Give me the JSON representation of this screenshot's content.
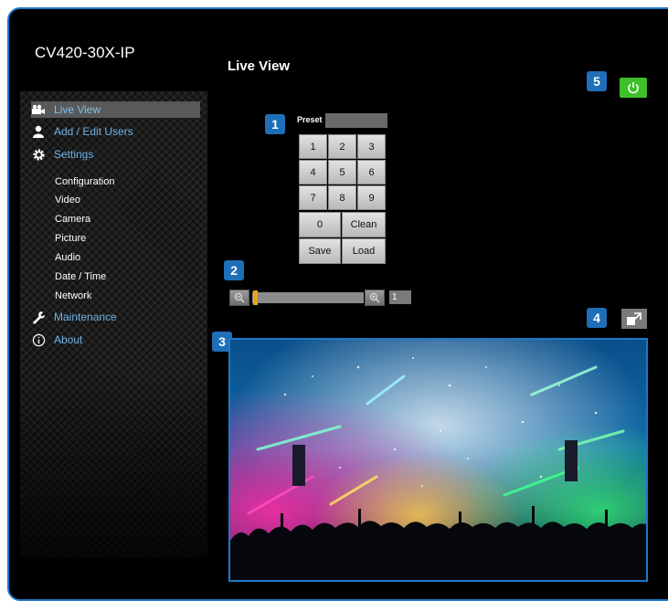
{
  "app_title": "CV420-30X-IP",
  "page_title": "Live View",
  "nav": {
    "items": [
      {
        "label": "Live View",
        "icon": "camera-icon"
      },
      {
        "label": "Add / Edit Users",
        "icon": "user-icon"
      },
      {
        "label": "Settings",
        "icon": "gear-icon"
      },
      {
        "label": "Maintenance",
        "icon": "wrench-icon"
      },
      {
        "label": "About",
        "icon": "info-icon"
      }
    ],
    "settings_sub": [
      "Configuration",
      "Video",
      "Camera",
      "Picture",
      "Audio",
      "Date / Time",
      "Network"
    ]
  },
  "preset": {
    "label": "Preset",
    "input_value": "",
    "keys": [
      "1",
      "2",
      "3",
      "4",
      "5",
      "6",
      "7",
      "8",
      "9",
      "0",
      "Clean",
      "Save",
      "Load"
    ]
  },
  "zoom": {
    "value": "1",
    "level": 0.0
  },
  "badges": [
    "1",
    "2",
    "3",
    "4",
    "5"
  ],
  "colors": {
    "accent": "#1f78c8",
    "power": "#3fbf2a",
    "slider_thumb": "#f0a020",
    "nav_text": "#6fb3e6"
  }
}
